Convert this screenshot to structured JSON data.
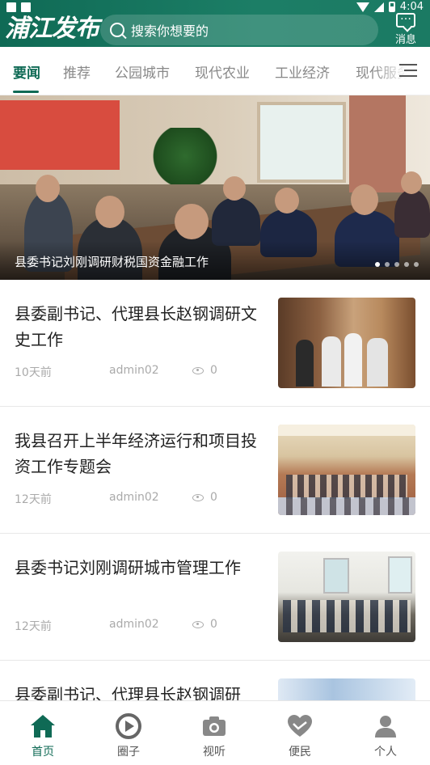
{
  "status_bar": {
    "time": "4:04"
  },
  "header": {
    "logo": "浦江发布",
    "search_placeholder": "搜索你想要的",
    "message_label": "消息"
  },
  "tabs": [
    {
      "label": "要闻",
      "active": true
    },
    {
      "label": "推荐",
      "active": false
    },
    {
      "label": "公园城市",
      "active": false
    },
    {
      "label": "现代农业",
      "active": false
    },
    {
      "label": "工业经济",
      "active": false
    },
    {
      "label": "现代服务业",
      "active": false
    }
  ],
  "banner": {
    "caption": "县委书记刘刚调研财税国资金融工作",
    "slides_total": 5,
    "active_slide": 1
  },
  "news": [
    {
      "title": "县委副书记、代理县长赵钢调研文史工作",
      "time": "10天前",
      "author": "admin02",
      "views": "0"
    },
    {
      "title": "我县召开上半年经济运行和项目投资工作专题会",
      "time": "12天前",
      "author": "admin02",
      "views": "0"
    },
    {
      "title": "县委书记刘刚调研城市管理工作",
      "time": "12天前",
      "author": "admin02",
      "views": "0"
    },
    {
      "title": "县委副书记、代理县长赵钢调研",
      "time": "",
      "author": "",
      "views": ""
    }
  ],
  "bottom_nav": [
    {
      "label": "首页",
      "icon": "home-icon",
      "active": true
    },
    {
      "label": "圈子",
      "icon": "circle-play-icon",
      "active": false
    },
    {
      "label": "视听",
      "icon": "camera-icon",
      "active": false
    },
    {
      "label": "便民",
      "icon": "heart-hands-icon",
      "active": false
    },
    {
      "label": "个人",
      "icon": "person-icon",
      "active": false
    }
  ],
  "colors": {
    "brand": "#0f6a55",
    "inactive_text": "#888888",
    "meta_text": "#aaaaaa"
  }
}
